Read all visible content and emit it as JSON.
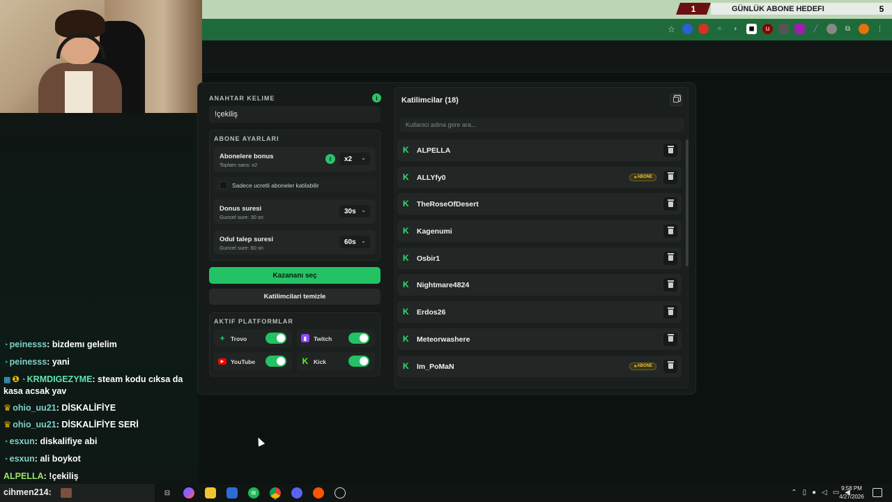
{
  "overlay": {
    "goal_number": "1",
    "goal_label": "GÜNLÜK ABONE HEDEFI",
    "goal_count": "5"
  },
  "keyword": {
    "label": "ANAHTAR KELIME",
    "value": "!çekiliş"
  },
  "subscriber_settings": {
    "label": "ABONE AYARLARI",
    "bonus": {
      "title": "Abonelere bonus",
      "subtitle": "Toplam sans: x2",
      "value": "x2"
    },
    "paid_only": {
      "label": "Sadece ucretli aboneler katilabilir",
      "checked": false
    },
    "duration": {
      "title": "Donus suresi",
      "subtitle": "Guncel sure: 30 sn",
      "value": "30s"
    },
    "claim": {
      "title": "Odul talep suresi",
      "subtitle": "Guncel sure: 60 sn",
      "value": "60s"
    }
  },
  "buttons": {
    "pick_winner": "Kazananı seç",
    "clear_participants": "Katilimcilari temizle"
  },
  "platforms": {
    "label": "AKTIF PLATFORMLAR",
    "items": [
      {
        "name": "Trovo",
        "enabled": true,
        "color": "#19a05a"
      },
      {
        "name": "Twitch",
        "enabled": true,
        "color": "#9146ff"
      },
      {
        "name": "YouTube",
        "enabled": true,
        "color": "#ff0000"
      },
      {
        "name": "Kick",
        "enabled": true,
        "color": "#53fc18"
      }
    ]
  },
  "participants": {
    "title": "Katilimcilar (18)",
    "search_placeholder": "Kullanici adina gore ara...",
    "badge_label": "ABONE",
    "items": [
      {
        "name": "ALPELLA",
        "subscriber": false
      },
      {
        "name": "ALLYfy0",
        "subscriber": true
      },
      {
        "name": "TheRoseOfDesert",
        "subscriber": false
      },
      {
        "name": "Kagenumi",
        "subscriber": false
      },
      {
        "name": "Osbir1",
        "subscriber": false
      },
      {
        "name": "Nightmare4824",
        "subscriber": false
      },
      {
        "name": "Erdos26",
        "subscriber": false
      },
      {
        "name": "Meteorwashere",
        "subscriber": false
      },
      {
        "name": "Im_PoMaN",
        "subscriber": true
      }
    ]
  },
  "chat": [
    {
      "user": "peinesss",
      "text": "bizdemı gelelim",
      "badge": "emote"
    },
    {
      "user": "peinesss",
      "text": "yani",
      "badge": "emote"
    },
    {
      "user": "KRMDIGEZYME",
      "text": "steam kodu cıksa da kasa acsak yav",
      "badge": "sub"
    },
    {
      "user": "ohio_uu21",
      "text": "DİSKALİFİYE",
      "badge": "crown"
    },
    {
      "user": "ohio_uu21",
      "text": "DİSKALİFİYE SERİ",
      "badge": "crown"
    },
    {
      "user": "esxun",
      "text": "diskalifiye abi",
      "badge": "emote"
    },
    {
      "user": "esxun",
      "text": "ali boykot",
      "badge": "emote"
    },
    {
      "user": "ALPELLA",
      "text": "!çekiliş",
      "badge": "none"
    }
  ],
  "taskbar": {
    "search_text": "cihmen214:",
    "time": "9:58 PM",
    "date": "4/27/2026"
  }
}
